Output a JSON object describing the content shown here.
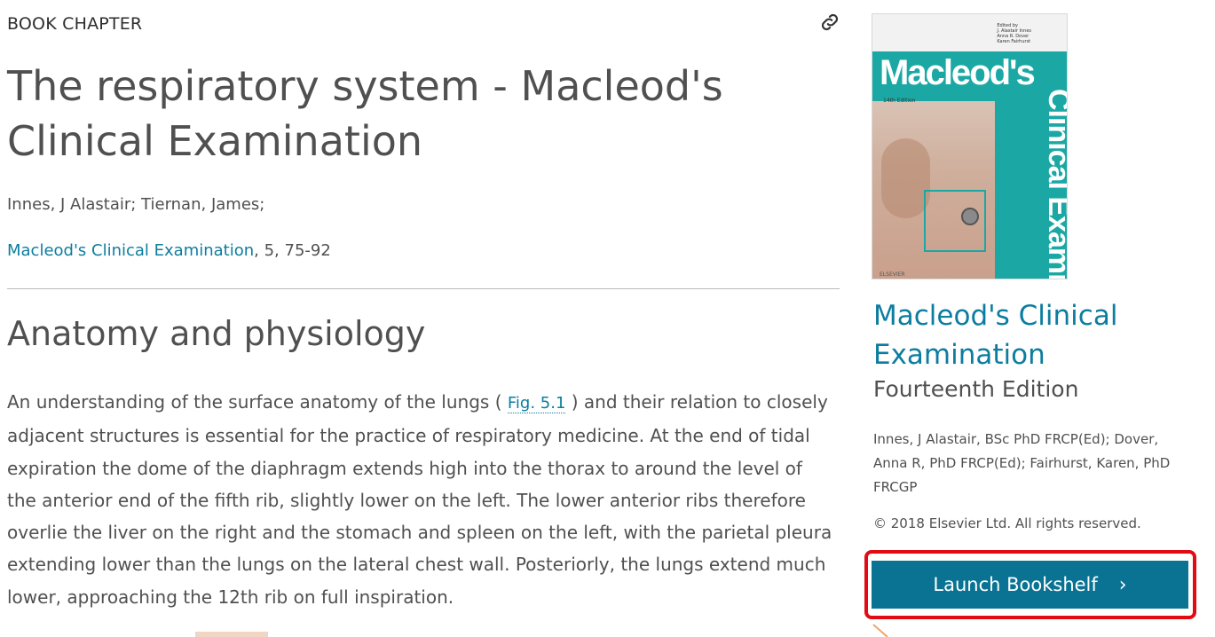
{
  "main": {
    "content_type": "BOOK CHAPTER",
    "title": "The respiratory system - Macleod's Clinical Examination",
    "authors": "Innes, J Alastair; Tiernan, James;",
    "source": {
      "book_link": "Macleod's Clinical Examination",
      "details": ", 5, 75-92"
    },
    "section": {
      "heading": "Anatomy and physiology",
      "para_before": "An understanding of the surface anatomy of the lungs ( ",
      "fig_link": "Fig. 5.1",
      "para_after": " ) and their relation to closely adjacent structures is essential for the practice of respiratory medicine. At the end of tidal expiration the dome of the diaphragm extends high into the thorax to around the level of the anterior end of the fifth rib, slightly lower on the left. The lower anterior ribs therefore overlie the liver on the right and the stomach and spleen on the left, with the parietal pleura extending lower than the lungs on the lateral chest wall. Posteriorly, the lungs extend much lower, approaching the 12th rib on full inspiration."
    },
    "icons": {
      "link": "link-icon"
    }
  },
  "sidebar": {
    "cover": {
      "editors": [
        "Edited by",
        "J. Alastair Innes",
        "Anna R. Dover",
        "Karen Fairhurst"
      ],
      "title": "Macleod's",
      "vertical_title": "Clinical Examination",
      "edition": "14th Edition",
      "publisher": "ELSEVIER"
    },
    "book_title": "Macleod's Clinical Examination",
    "edition": "Fourteenth Edition",
    "authors": "Innes, J Alastair, BSc PhD FRCP(Ed); Dover, Anna R, PhD FRCP(Ed); Fairhurst, Karen, PhD FRCGP",
    "copyright": "© 2018 Elsevier Ltd. All rights reserved.",
    "launch_button": "Launch Bookshelf",
    "launch_chevron": "›"
  },
  "colors": {
    "link": "#0c7da0",
    "button": "#0a7394",
    "highlight": "#e10b14",
    "cover_teal": "#1ba8a5"
  }
}
